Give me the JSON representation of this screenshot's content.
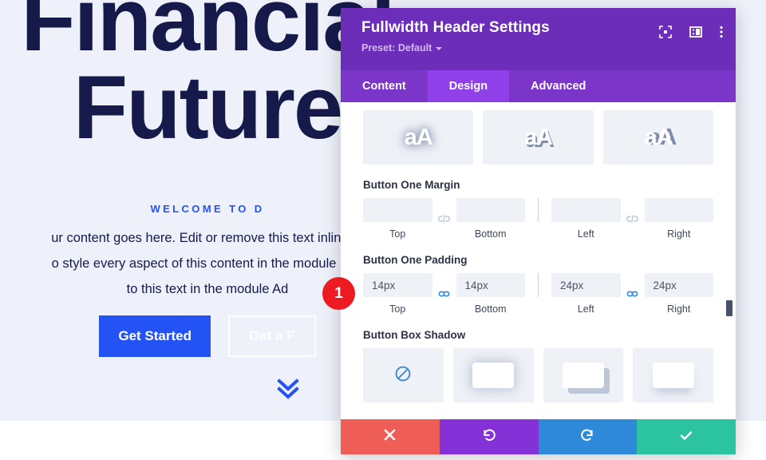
{
  "background_page": {
    "hero_title_line1": "Financial",
    "hero_title_line2": "Future",
    "eyebrow": "WELCOME TO D",
    "body_line1": "ur content goes here. Edit or remove this text inline or",
    "body_line2": "o style every aspect of this content in the module Des",
    "body_line3": "to this text in the module Ad",
    "primary_button": "Get Started",
    "ghost_button": "Get a F",
    "scroll_icon": "double-chevron-down-icon",
    "colors": {
      "hero_bg": "#eef1fa",
      "title": "#151a4a",
      "accent_blue": "#2453f5"
    }
  },
  "step_badge": {
    "number": "1",
    "color": "#eb1b21"
  },
  "modal": {
    "title": "Fullwidth Header Settings",
    "preset_label": "Preset: Default",
    "header_icons": [
      {
        "name": "focus-target-icon"
      },
      {
        "name": "panel-layout-icon"
      },
      {
        "name": "more-vertical-icon"
      }
    ],
    "tabs": [
      {
        "label": "Content",
        "active": false
      },
      {
        "label": "Design",
        "active": true
      },
      {
        "label": "Advanced",
        "active": false
      }
    ],
    "colors": {
      "header_bg": "#6c2eb9",
      "tab_bar_bg": "#7b35c9",
      "tab_active_bg": "#9040e8"
    },
    "sections": {
      "text_shadow_presets": {
        "options": [
          {
            "label": "aA",
            "shadow": "glow",
            "selected": true
          },
          {
            "label": "aA",
            "shadow": "offset",
            "selected": false
          },
          {
            "label": "aA",
            "shadow": "right",
            "selected": false
          }
        ]
      },
      "button_one_margin": {
        "label": "Button One Margin",
        "linked_left": false,
        "linked_right": false,
        "fields": [
          {
            "sub": "Top",
            "value": "",
            "placeholder": ""
          },
          {
            "sub": "Bottom",
            "value": "",
            "placeholder": ""
          },
          {
            "sub": "Left",
            "value": "",
            "placeholder": ""
          },
          {
            "sub": "Right",
            "value": "",
            "placeholder": ""
          }
        ]
      },
      "button_one_padding": {
        "label": "Button One Padding",
        "linked_left": true,
        "linked_right": true,
        "fields": [
          {
            "sub": "Top",
            "value": "14px",
            "placeholder": ""
          },
          {
            "sub": "Bottom",
            "value": "14px",
            "placeholder": ""
          },
          {
            "sub": "Left",
            "value": "24px",
            "placeholder": ""
          },
          {
            "sub": "Right",
            "value": "24px",
            "placeholder": ""
          }
        ]
      },
      "button_box_shadow": {
        "label": "Button Box Shadow",
        "options": [
          {
            "name": "no-shadow",
            "selected": true
          },
          {
            "name": "soft-glow",
            "selected": false
          },
          {
            "name": "offset-hard",
            "selected": false
          },
          {
            "name": "bottom-soft",
            "selected": false
          }
        ]
      }
    },
    "footer_buttons": [
      {
        "name": "cancel-button",
        "icon": "close-icon",
        "color": "#ee5e57"
      },
      {
        "name": "undo-button",
        "icon": "undo-icon",
        "color": "#8432d8"
      },
      {
        "name": "redo-button",
        "icon": "redo-icon",
        "color": "#2e8ad8"
      },
      {
        "name": "save-button",
        "icon": "checkmark-icon",
        "color": "#2cc4a0"
      }
    ]
  }
}
